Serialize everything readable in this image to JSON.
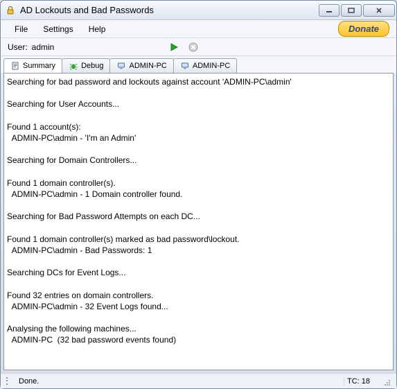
{
  "window": {
    "title": "AD Lockouts and Bad Passwords"
  },
  "menu": {
    "file": "File",
    "settings": "Settings",
    "help": "Help",
    "donate": "Donate"
  },
  "userbar": {
    "label": "User:",
    "value": "admin"
  },
  "tabs": [
    {
      "label": "Summary"
    },
    {
      "label": "Debug"
    },
    {
      "label": "ADMIN-PC"
    },
    {
      "label": "ADMIN-PC"
    }
  ],
  "log": "Searching for bad password and lockouts against account 'ADMIN-PC\\admin'\n\nSearching for User Accounts...\n\nFound 1 account(s):\n  ADMIN-PC\\admin - 'I'm an Admin'\n\nSearching for Domain Controllers...\n\nFound 1 domain controller(s).\n  ADMIN-PC\\admin - 1 Domain controller found.\n\nSearching for Bad Password Attempts on each DC...\n\nFound 1 domain controller(s) marked as bad password\\lockout.\n  ADMIN-PC\\admin - Bad Passwords: 1\n\nSearching DCs for Event Logs...\n\nFound 32 entries on domain controllers.\n  ADMIN-PC\\admin - 32 Event Logs found...\n\nAnalysing the following machines...\n  ADMIN-PC  (32 bad password events found)",
  "status": {
    "text": "Done.",
    "tc": "TC: 18"
  }
}
